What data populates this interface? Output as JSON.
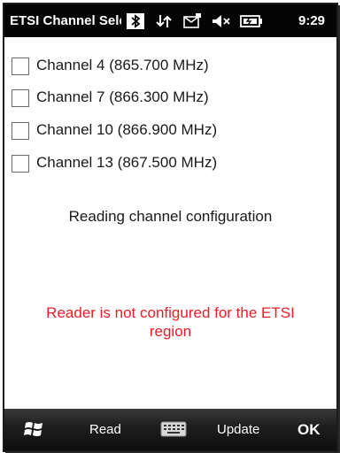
{
  "titlebar": {
    "title": "ETSI Channel Selec",
    "time": "9:29",
    "icons": [
      "bluetooth-icon",
      "connectivity-icon",
      "message-icon",
      "volume-mute-icon",
      "battery-icon"
    ]
  },
  "channels": [
    {
      "label": "Channel 4 (865.700 MHz)",
      "checked": false
    },
    {
      "label": "Channel 7 (866.300 MHz)",
      "checked": false
    },
    {
      "label": "Channel 10 (866.900 MHz)",
      "checked": false
    },
    {
      "label": "Channel 13 (867.500 MHz)",
      "checked": false
    }
  ],
  "status_message": "Reading channel configuration",
  "error_message": "Reader is not configured for the ETSI region",
  "menubar": {
    "start_icon": "windows-start-icon",
    "read_label": "Read",
    "keyboard_icon": "keyboard-icon",
    "update_label": "Update",
    "ok_label": "OK"
  },
  "colors": {
    "titlebar_bg": "#050505",
    "error_text": "#ee1c24",
    "menubar_bg": "#1a1a1a"
  }
}
